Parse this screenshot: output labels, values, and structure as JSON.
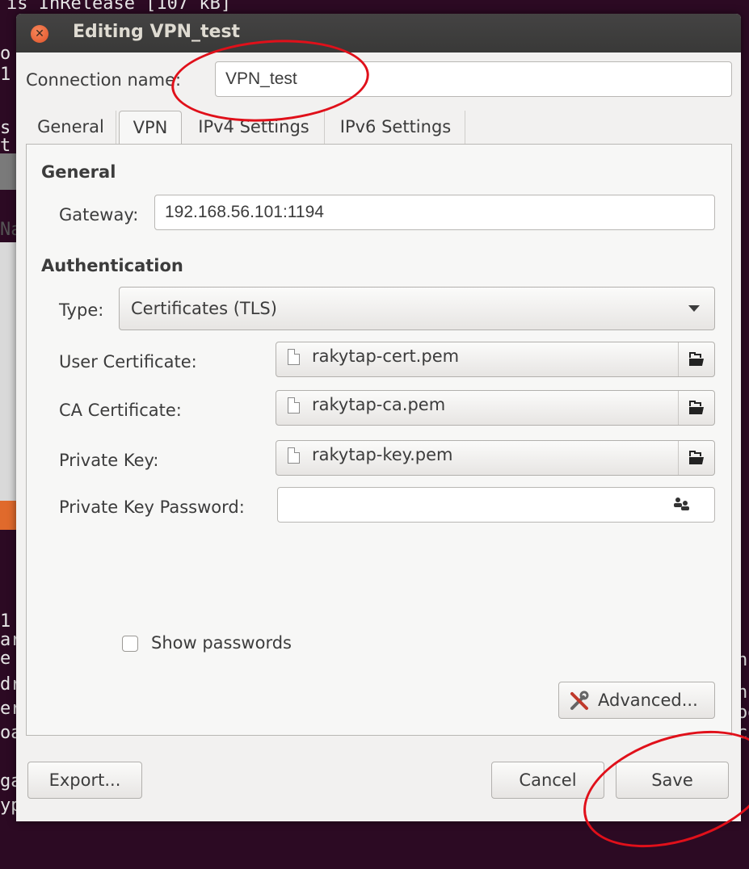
{
  "terminal": {
    "top_line": "is InRelease [107 kB]",
    "left_chars": [
      "o",
      "1",
      "s",
      "t",
      "Na",
      "1",
      "ar",
      "e",
      "dr",
      "er",
      "oa",
      "ga",
      "ypt"
    ],
    "right_chars": [
      "nc",
      "nc",
      "od",
      "cs"
    ]
  },
  "window": {
    "title": "Editing VPN_test",
    "close_glyph": "✕"
  },
  "connection": {
    "label": "Connection name:",
    "value": "VPN_test"
  },
  "tabs": [
    "General",
    "VPN",
    "IPv4 Settings",
    "IPv6 Settings"
  ],
  "active_tab": "VPN",
  "general_section": {
    "heading": "General",
    "gateway_label": "Gateway:",
    "gateway_value": "192.168.56.101:1194"
  },
  "auth_section": {
    "heading": "Authentication",
    "type_label": "Type:",
    "type_value": "Certificates (TLS)",
    "user_cert_label": "User Certificate:",
    "user_cert_value": "rakytap-cert.pem",
    "ca_cert_label": "CA Certificate:",
    "ca_cert_value": "rakytap-ca.pem",
    "private_key_label": "Private Key:",
    "private_key_value": "rakytap-key.pem",
    "private_key_password_label": "Private Key Password:",
    "private_key_password_value": ""
  },
  "show_passwords_label": "Show passwords",
  "advanced_label": "Advanced...",
  "footer": {
    "export_label": "Export...",
    "cancel_label": "Cancel",
    "save_label": "Save"
  },
  "icons": {
    "close": "close-icon",
    "file": "file-icon",
    "open_folder": "folder-open-icon",
    "user_password_storage": "users-icon",
    "dropdown": "chevron-down-icon",
    "advanced": "tools-icon"
  },
  "colors": {
    "terminal_bg": "#2c0a23",
    "dialog_bg": "#f2f1f0",
    "titlebar": "#3c3b37",
    "close_button": "#ea6a3f",
    "annotation_circle": "#e0101a"
  }
}
